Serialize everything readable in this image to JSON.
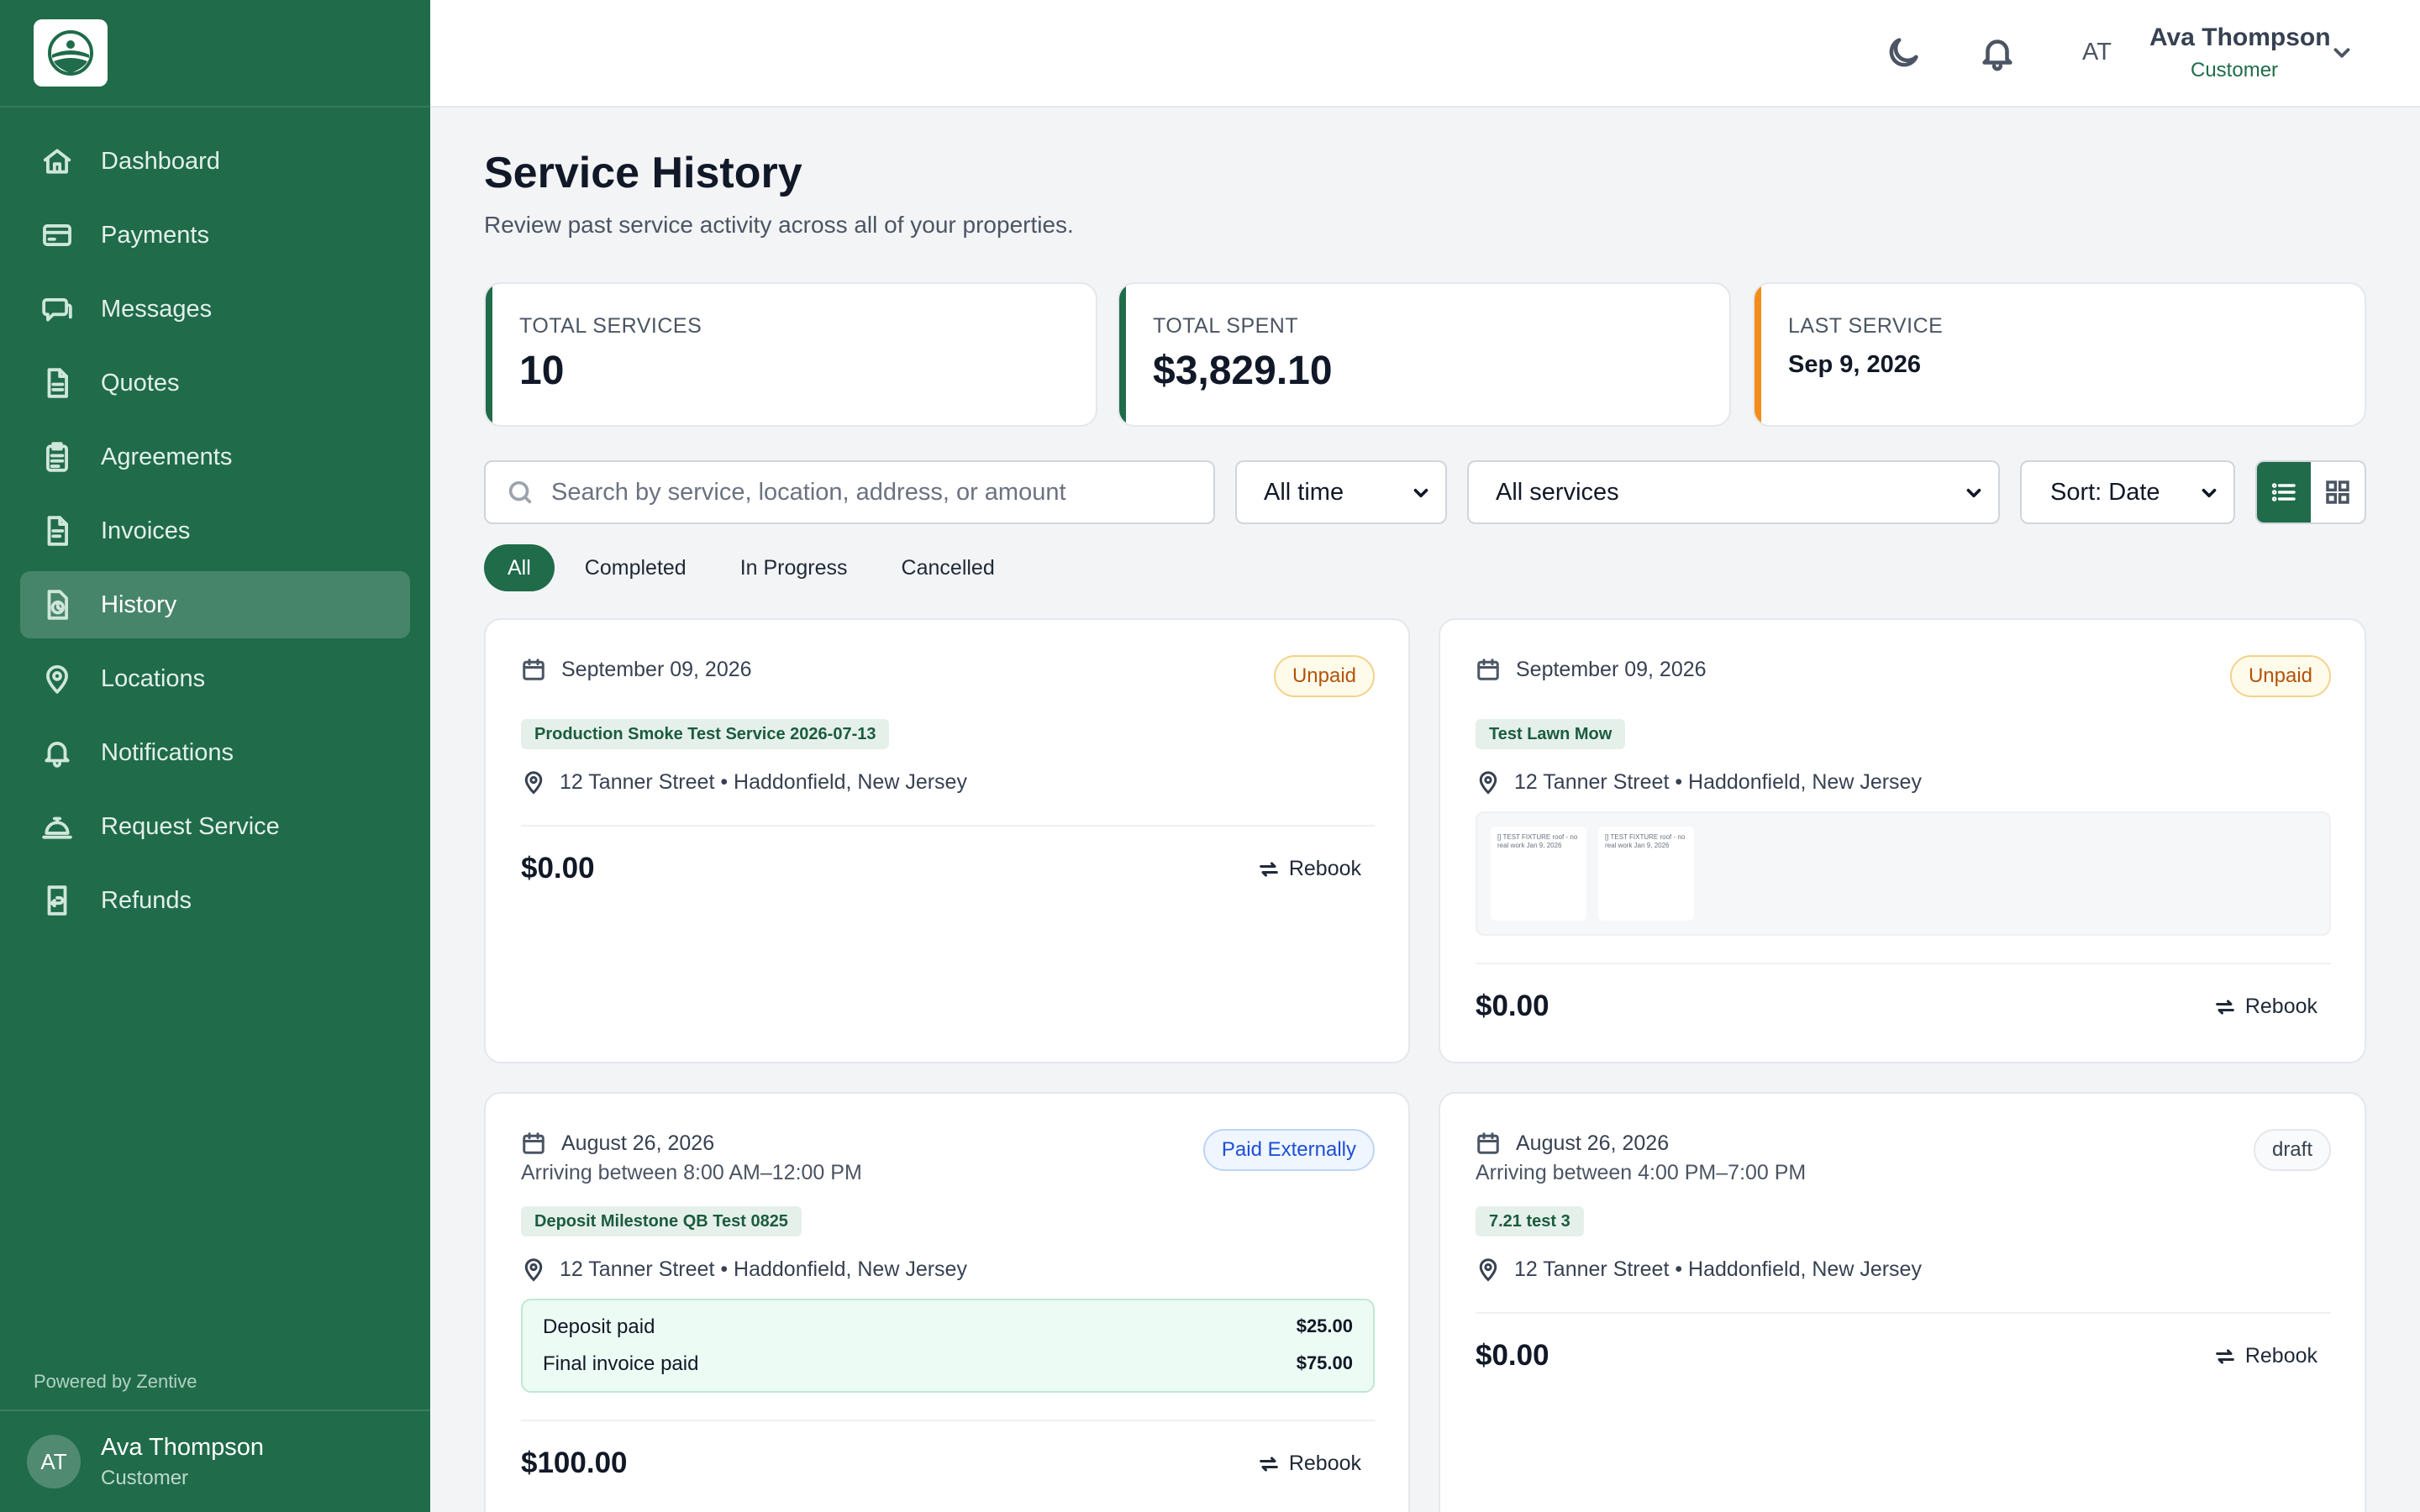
{
  "sidebar": {
    "logo_icon": "landscape-logo-icon",
    "nav": [
      {
        "label": "Dashboard",
        "icon": "home-icon"
      },
      {
        "label": "Payments",
        "icon": "credit-card-icon"
      },
      {
        "label": "Messages",
        "icon": "chat-icon"
      },
      {
        "label": "Quotes",
        "icon": "document-icon"
      },
      {
        "label": "Agreements",
        "icon": "clipboard-icon"
      },
      {
        "label": "Invoices",
        "icon": "invoice-icon"
      },
      {
        "label": "History",
        "icon": "history-icon",
        "active": true
      },
      {
        "label": "Locations",
        "icon": "map-pin-icon"
      },
      {
        "label": "Notifications",
        "icon": "bell-icon"
      },
      {
        "label": "Request Service",
        "icon": "service-bell-icon"
      },
      {
        "label": "Refunds",
        "icon": "refund-icon"
      }
    ],
    "powered_by": "Powered by Zentive",
    "user": {
      "initials": "AT",
      "name": "Ava Thompson",
      "role": "Customer"
    }
  },
  "topbar": {
    "theme_icon": "moon-icon",
    "notifications_icon": "bell-icon",
    "initials": "AT",
    "user_name": "Ava Thompson",
    "user_role": "Customer"
  },
  "page": {
    "title": "Service History",
    "subtitle": "Review past service activity across all of your properties."
  },
  "stats": [
    {
      "label": "TOTAL SERVICES",
      "value": "10",
      "accent": "#1f6b4a"
    },
    {
      "label": "TOTAL SPENT",
      "value": "$3,829.10",
      "accent": "#1f6b4a"
    },
    {
      "label": "LAST SERVICE",
      "value": "Sep 9, 2026",
      "accent": "#f28c1b"
    }
  ],
  "filters": {
    "search_placeholder": "Search by service, location, address, or amount",
    "time": "All time",
    "services": "All services",
    "sort": "Sort: Date",
    "tabs": [
      "All",
      "Completed",
      "In Progress",
      "Cancelled"
    ],
    "active_tab": "All",
    "view_mode": "list"
  },
  "cards": [
    {
      "date": "September 09, 2026",
      "status": "Unpaid",
      "service": "Production Smoke Test Service 2026-07-13",
      "location": "12 Tanner Street • Haddonfield, New Jersey",
      "amount": "$0.00",
      "rebook": "Rebook"
    },
    {
      "date": "September 09, 2026",
      "status": "Unpaid",
      "service": "Test Lawn Mow",
      "location": "12 Tanner Street • Haddonfield, New Jersey",
      "photos": [
        {
          "text": "[] TEST FIXTURE roof - no real work Jan 9, 2026"
        },
        {
          "text": "[] TEST FIXTURE roof - no real work Jan 9, 2026"
        }
      ],
      "amount": "$0.00",
      "rebook": "Rebook"
    },
    {
      "date": "August 26, 2026",
      "arrival": "Arriving between 8:00 AM–12:00 PM",
      "status": "Paid Externally",
      "service": "Deposit Milestone QB Test 0825",
      "location": "12 Tanner Street • Haddonfield, New Jersey",
      "payments": [
        {
          "label": "Deposit paid",
          "value": "$25.00"
        },
        {
          "label": "Final invoice paid",
          "value": "$75.00"
        }
      ],
      "amount": "$100.00",
      "rebook": "Rebook"
    },
    {
      "date": "August 26, 2026",
      "arrival": "Arriving between 4:00 PM–7:00 PM",
      "status": "draft",
      "service": "7.21 test 3",
      "location": "12 Tanner Street • Haddonfield, New Jersey",
      "amount": "$0.00",
      "rebook": "Rebook"
    }
  ]
}
